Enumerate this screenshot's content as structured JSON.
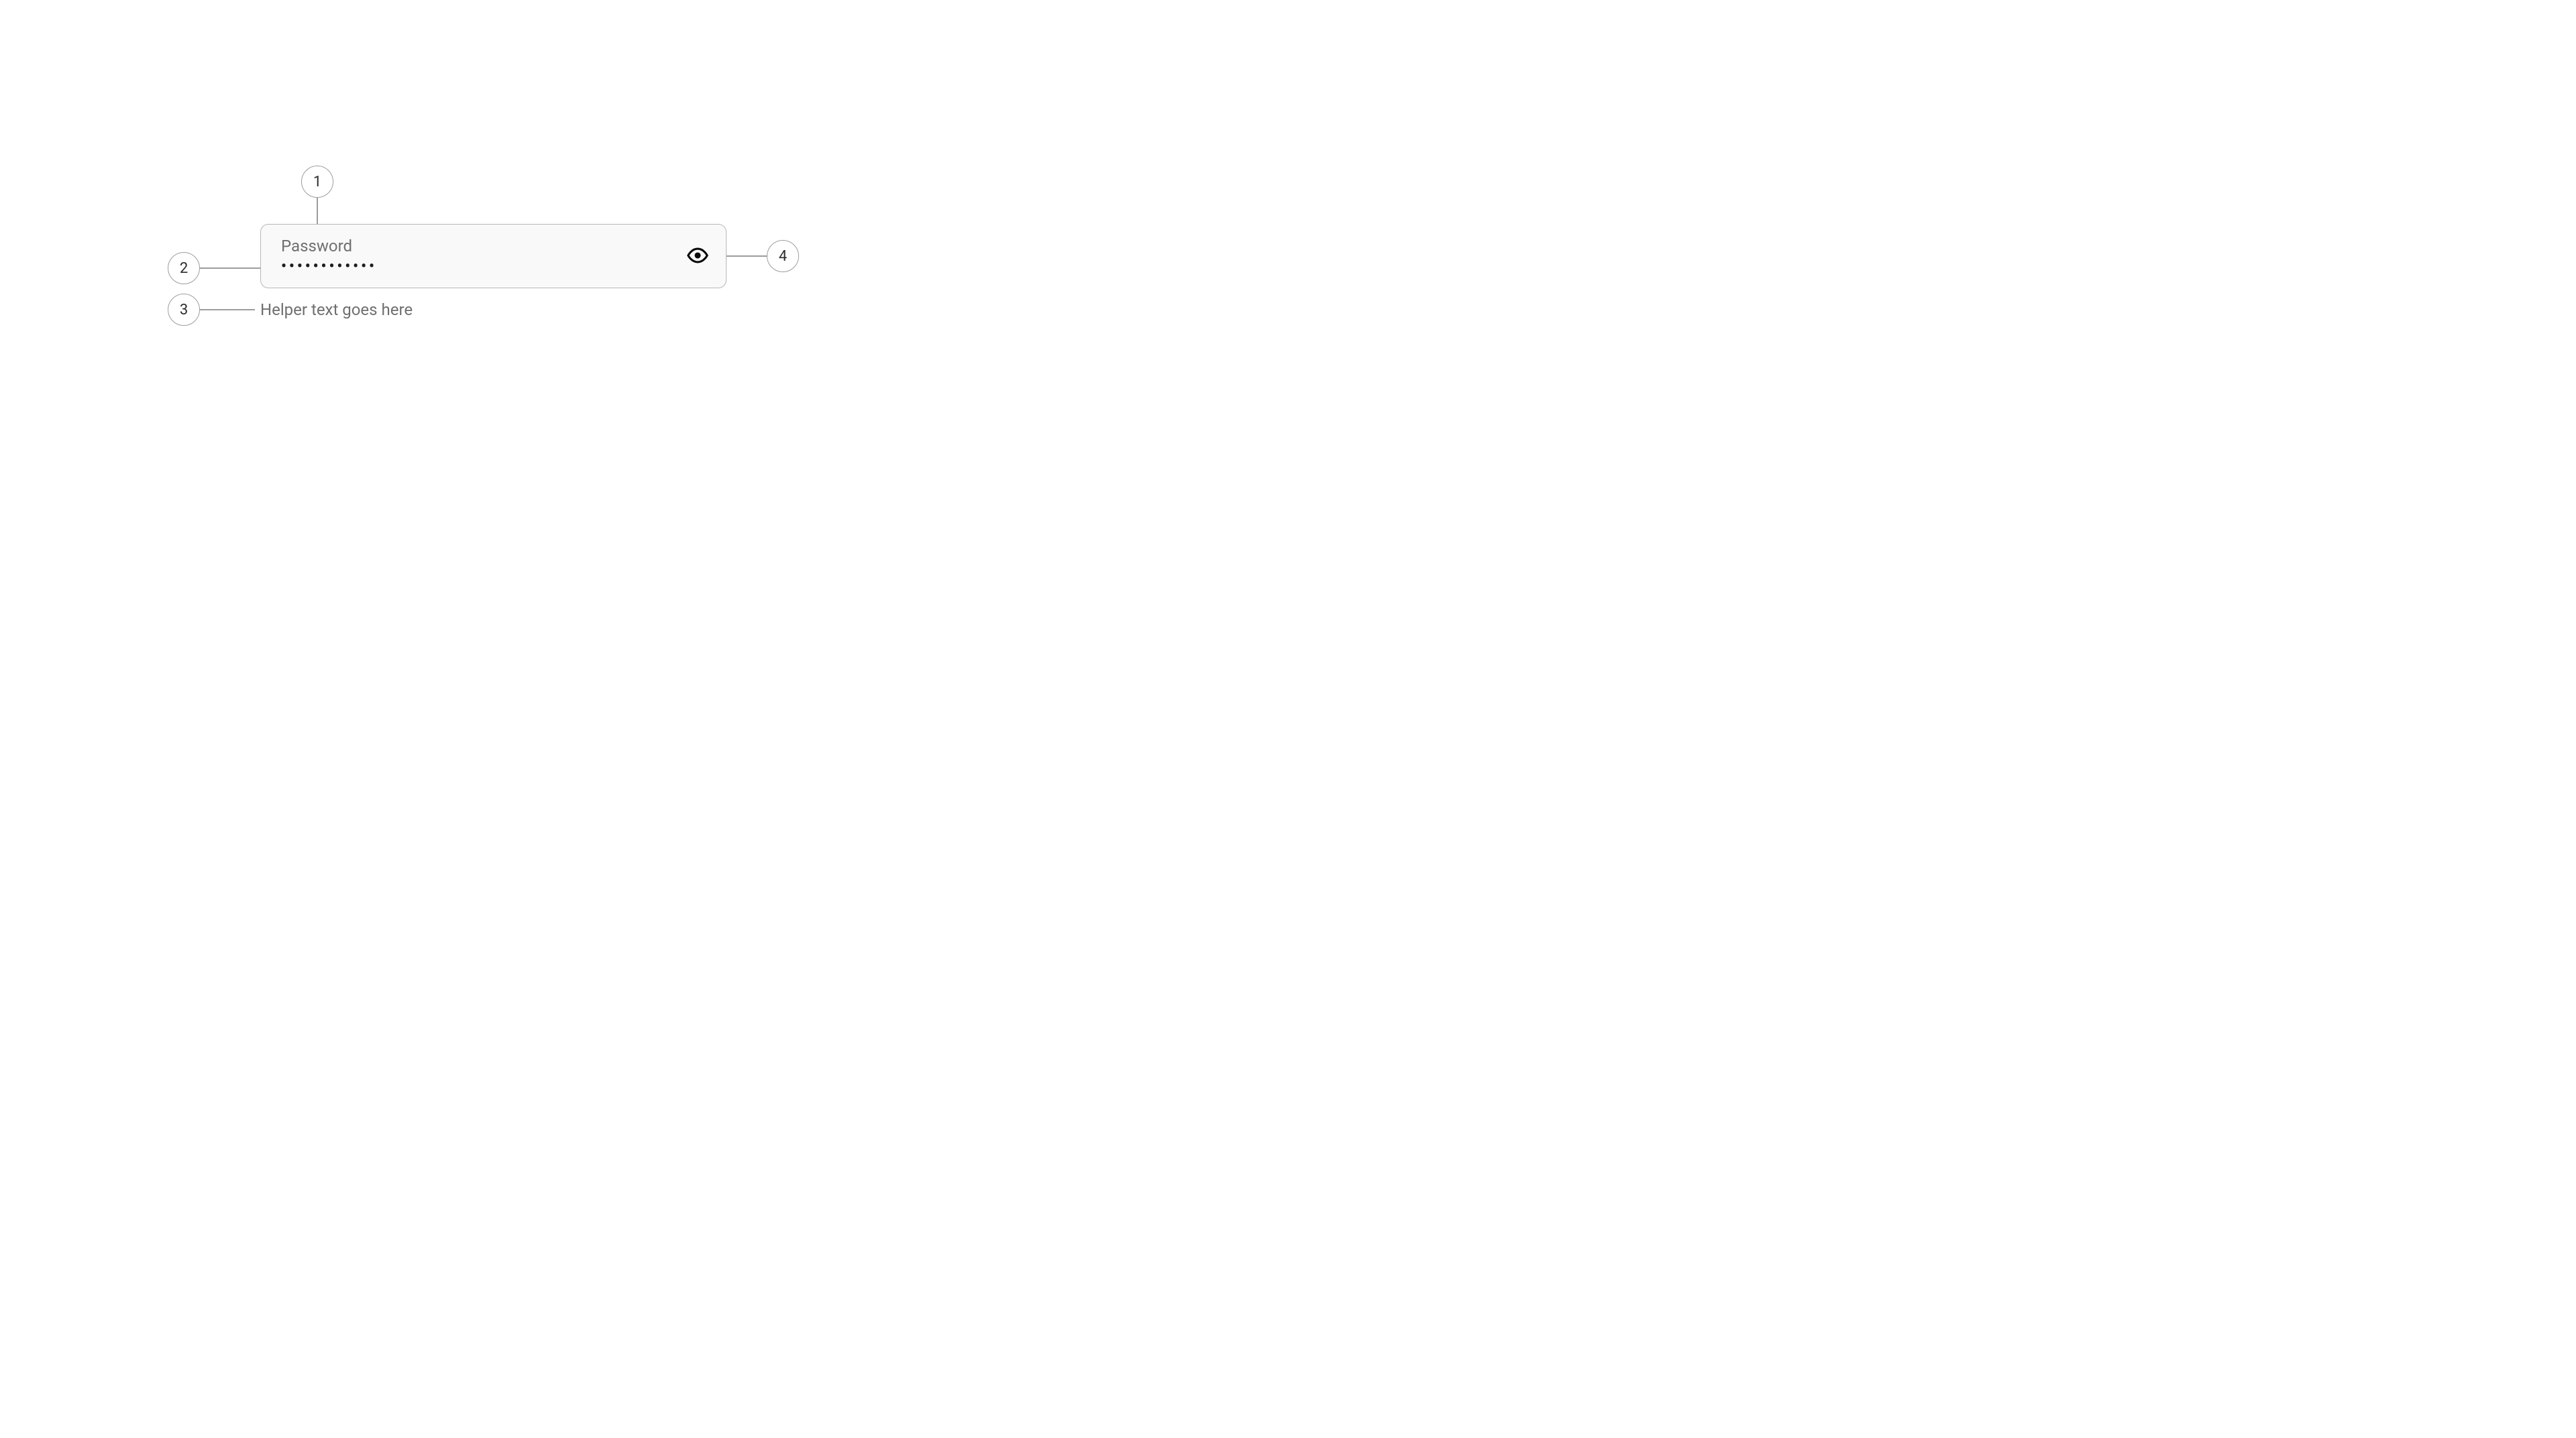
{
  "field": {
    "label": "Password",
    "masked_value": "••••••••••••",
    "helper": "Helper text goes here"
  },
  "callouts": {
    "c1": "1",
    "c2": "2",
    "c3": "3",
    "c4": "4"
  }
}
